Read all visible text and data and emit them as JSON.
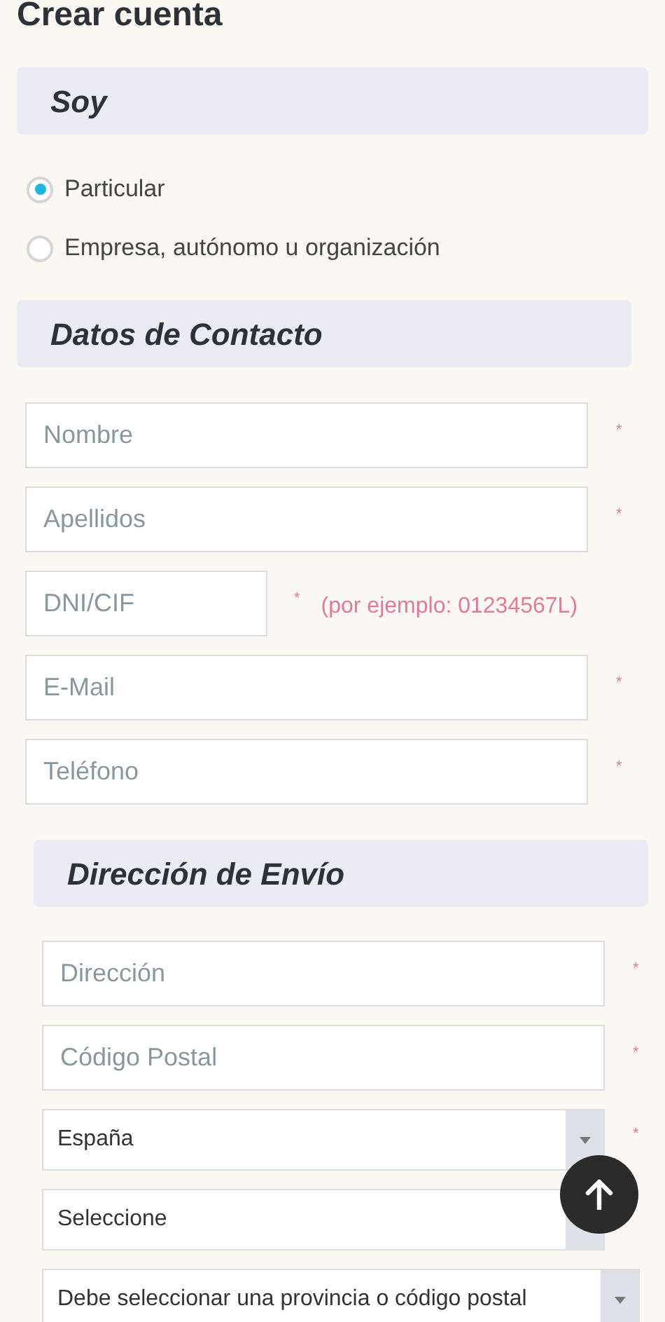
{
  "title": "Crear cuenta",
  "soy": {
    "heading": "Soy",
    "options": [
      {
        "label": "Particular",
        "selected": true
      },
      {
        "label": "Empresa, autónomo u organización",
        "selected": false
      }
    ]
  },
  "contacto": {
    "heading": "Datos de Contacto",
    "fields": [
      {
        "kind": "input",
        "placeholder": "Nombre",
        "mark": "*"
      },
      {
        "kind": "input",
        "placeholder": "Apellidos",
        "mark": "*"
      },
      {
        "kind": "short",
        "placeholder": "DNI/CIF",
        "mark": "*",
        "hint": "(por ejemplo: 01234567L)"
      },
      {
        "kind": "input",
        "placeholder": "E-Mail",
        "mark": "*"
      },
      {
        "kind": "input",
        "placeholder": "Teléfono",
        "mark": "*"
      }
    ]
  },
  "envio": {
    "heading": "Dirección de Envío",
    "fields": [
      {
        "kind": "input",
        "placeholder": "Dirección",
        "mark": "*"
      },
      {
        "kind": "input",
        "placeholder": "Código Postal",
        "mark": "*"
      },
      {
        "kind": "select",
        "value": "España",
        "mark": "*"
      },
      {
        "kind": "select",
        "value": "Seleccione"
      },
      {
        "kind": "wideselect",
        "value": "Debe seleccionar una provincia o código postal"
      }
    ]
  }
}
